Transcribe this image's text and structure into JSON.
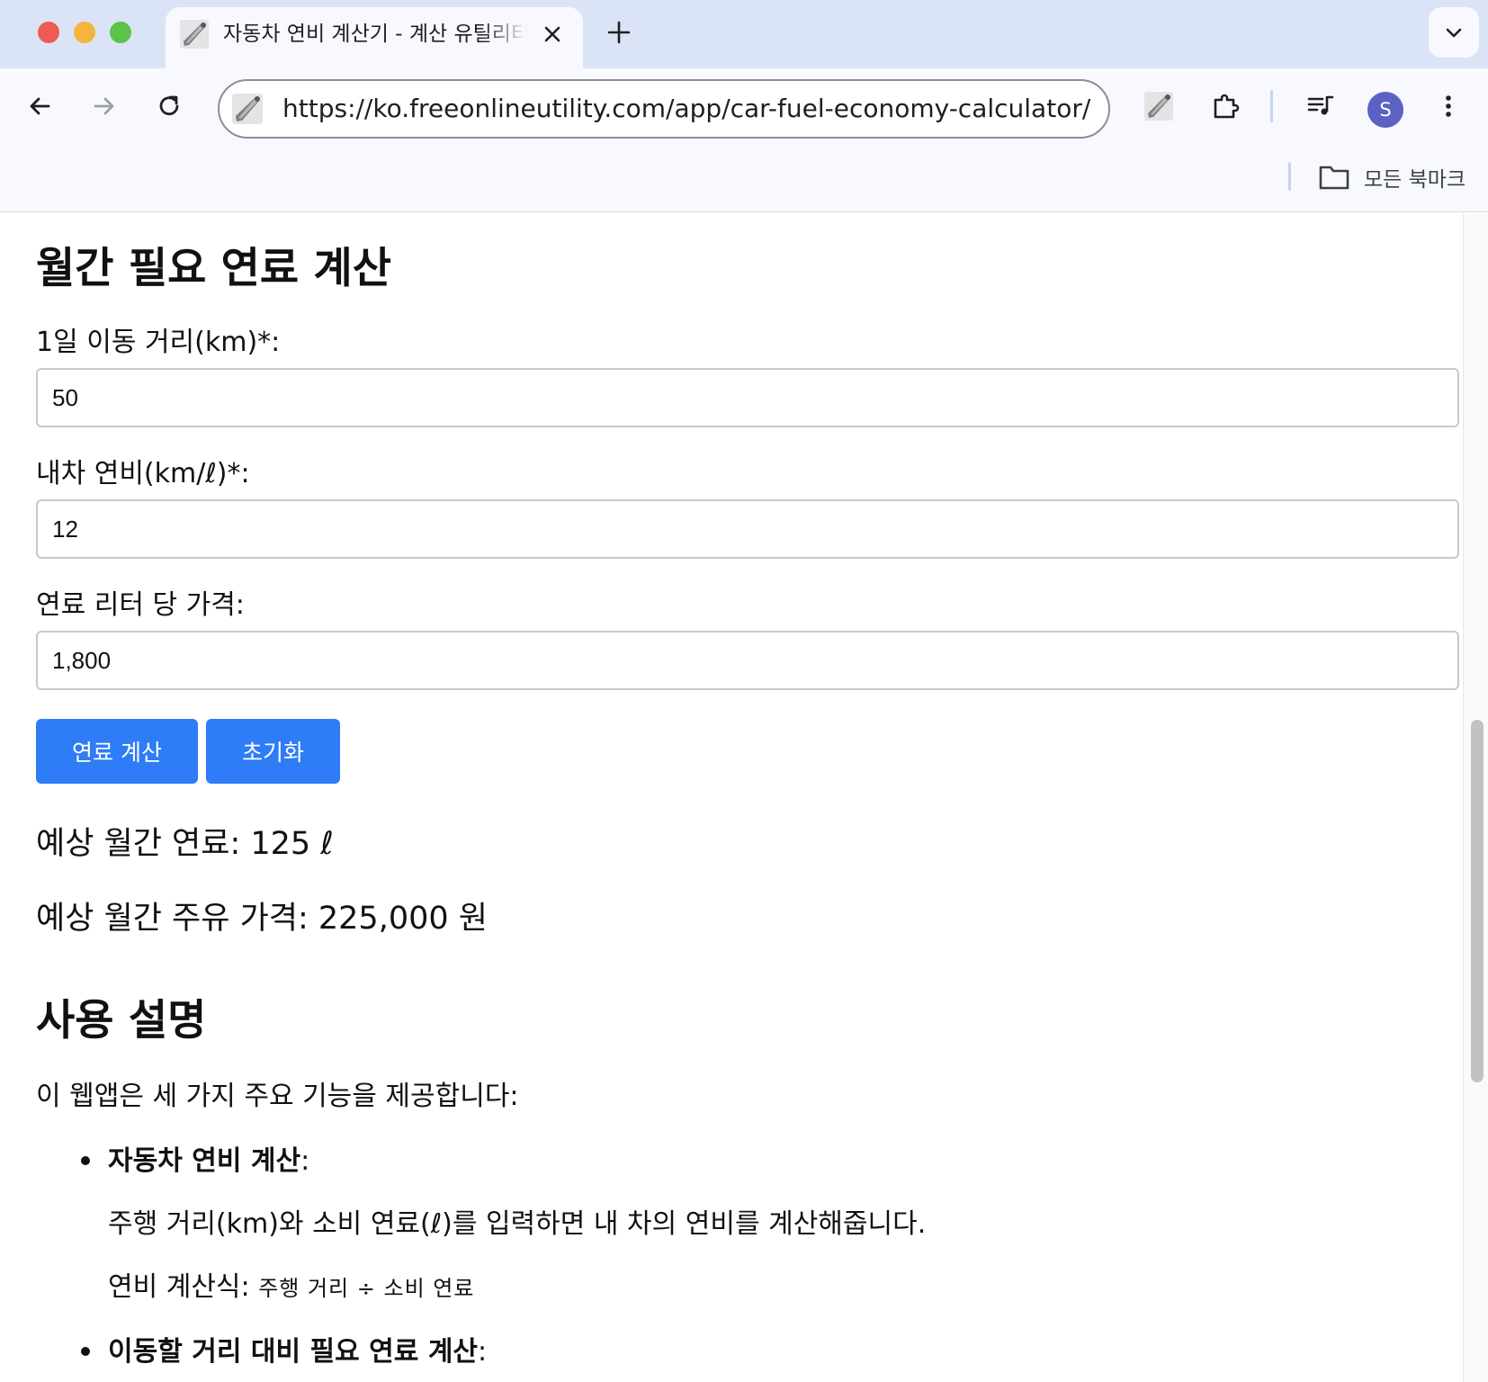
{
  "browser": {
    "tab_title": "자동차 연비 계산기 - 계산 유틸리티",
    "url": "https://ko.freeonlineutility.com/app/car-fuel-economy-calculator/",
    "avatar_letter": "S",
    "bookmarks_label": "모든 북마크",
    "icons": [
      "back-arrow-icon",
      "forward-arrow-icon",
      "reload-icon",
      "site-tool-icon",
      "extensions-icon",
      "media-icon",
      "more-vert-icon",
      "folder-icon",
      "close-icon",
      "plus-icon",
      "chevron-down-icon"
    ]
  },
  "calculator": {
    "heading": "월간 필요 연료 계산",
    "fields": [
      {
        "label": "1일 이동 거리(km)*:",
        "value": "50"
      },
      {
        "label": "내차 연비(km/ℓ)*:",
        "value": "12"
      },
      {
        "label": "연료 리터 당 가격:",
        "value": "1,800"
      }
    ],
    "calc_button": "연료 계산",
    "reset_button": "초기화",
    "result_fuel": "예상 월간 연료: 125 ℓ",
    "result_cost": "예상 월간 주유 가격: 225,000 원"
  },
  "usage": {
    "heading": "사용 설명",
    "intro": "이 웹앱은 세 가지 주요 기능을 제공합니다:",
    "items": [
      {
        "title": "자동차 연비 계산",
        "description": "주행 거리(km)와 소비 연료(ℓ)를 입력하면 내 차의 연비를 계산해줍니다.",
        "formula_label": "연비 계산식: ",
        "formula": "주행 거리 ÷ 소비 연료"
      },
      {
        "title": "이동할 거리 대비 필요 연료 계산"
      }
    ],
    "colon": ":"
  },
  "colors": {
    "accent": "#2e7cf6",
    "tabstrip": "#dbe4f6",
    "toolbar": "#f7f9fe",
    "avatar": "#5a62c4"
  }
}
